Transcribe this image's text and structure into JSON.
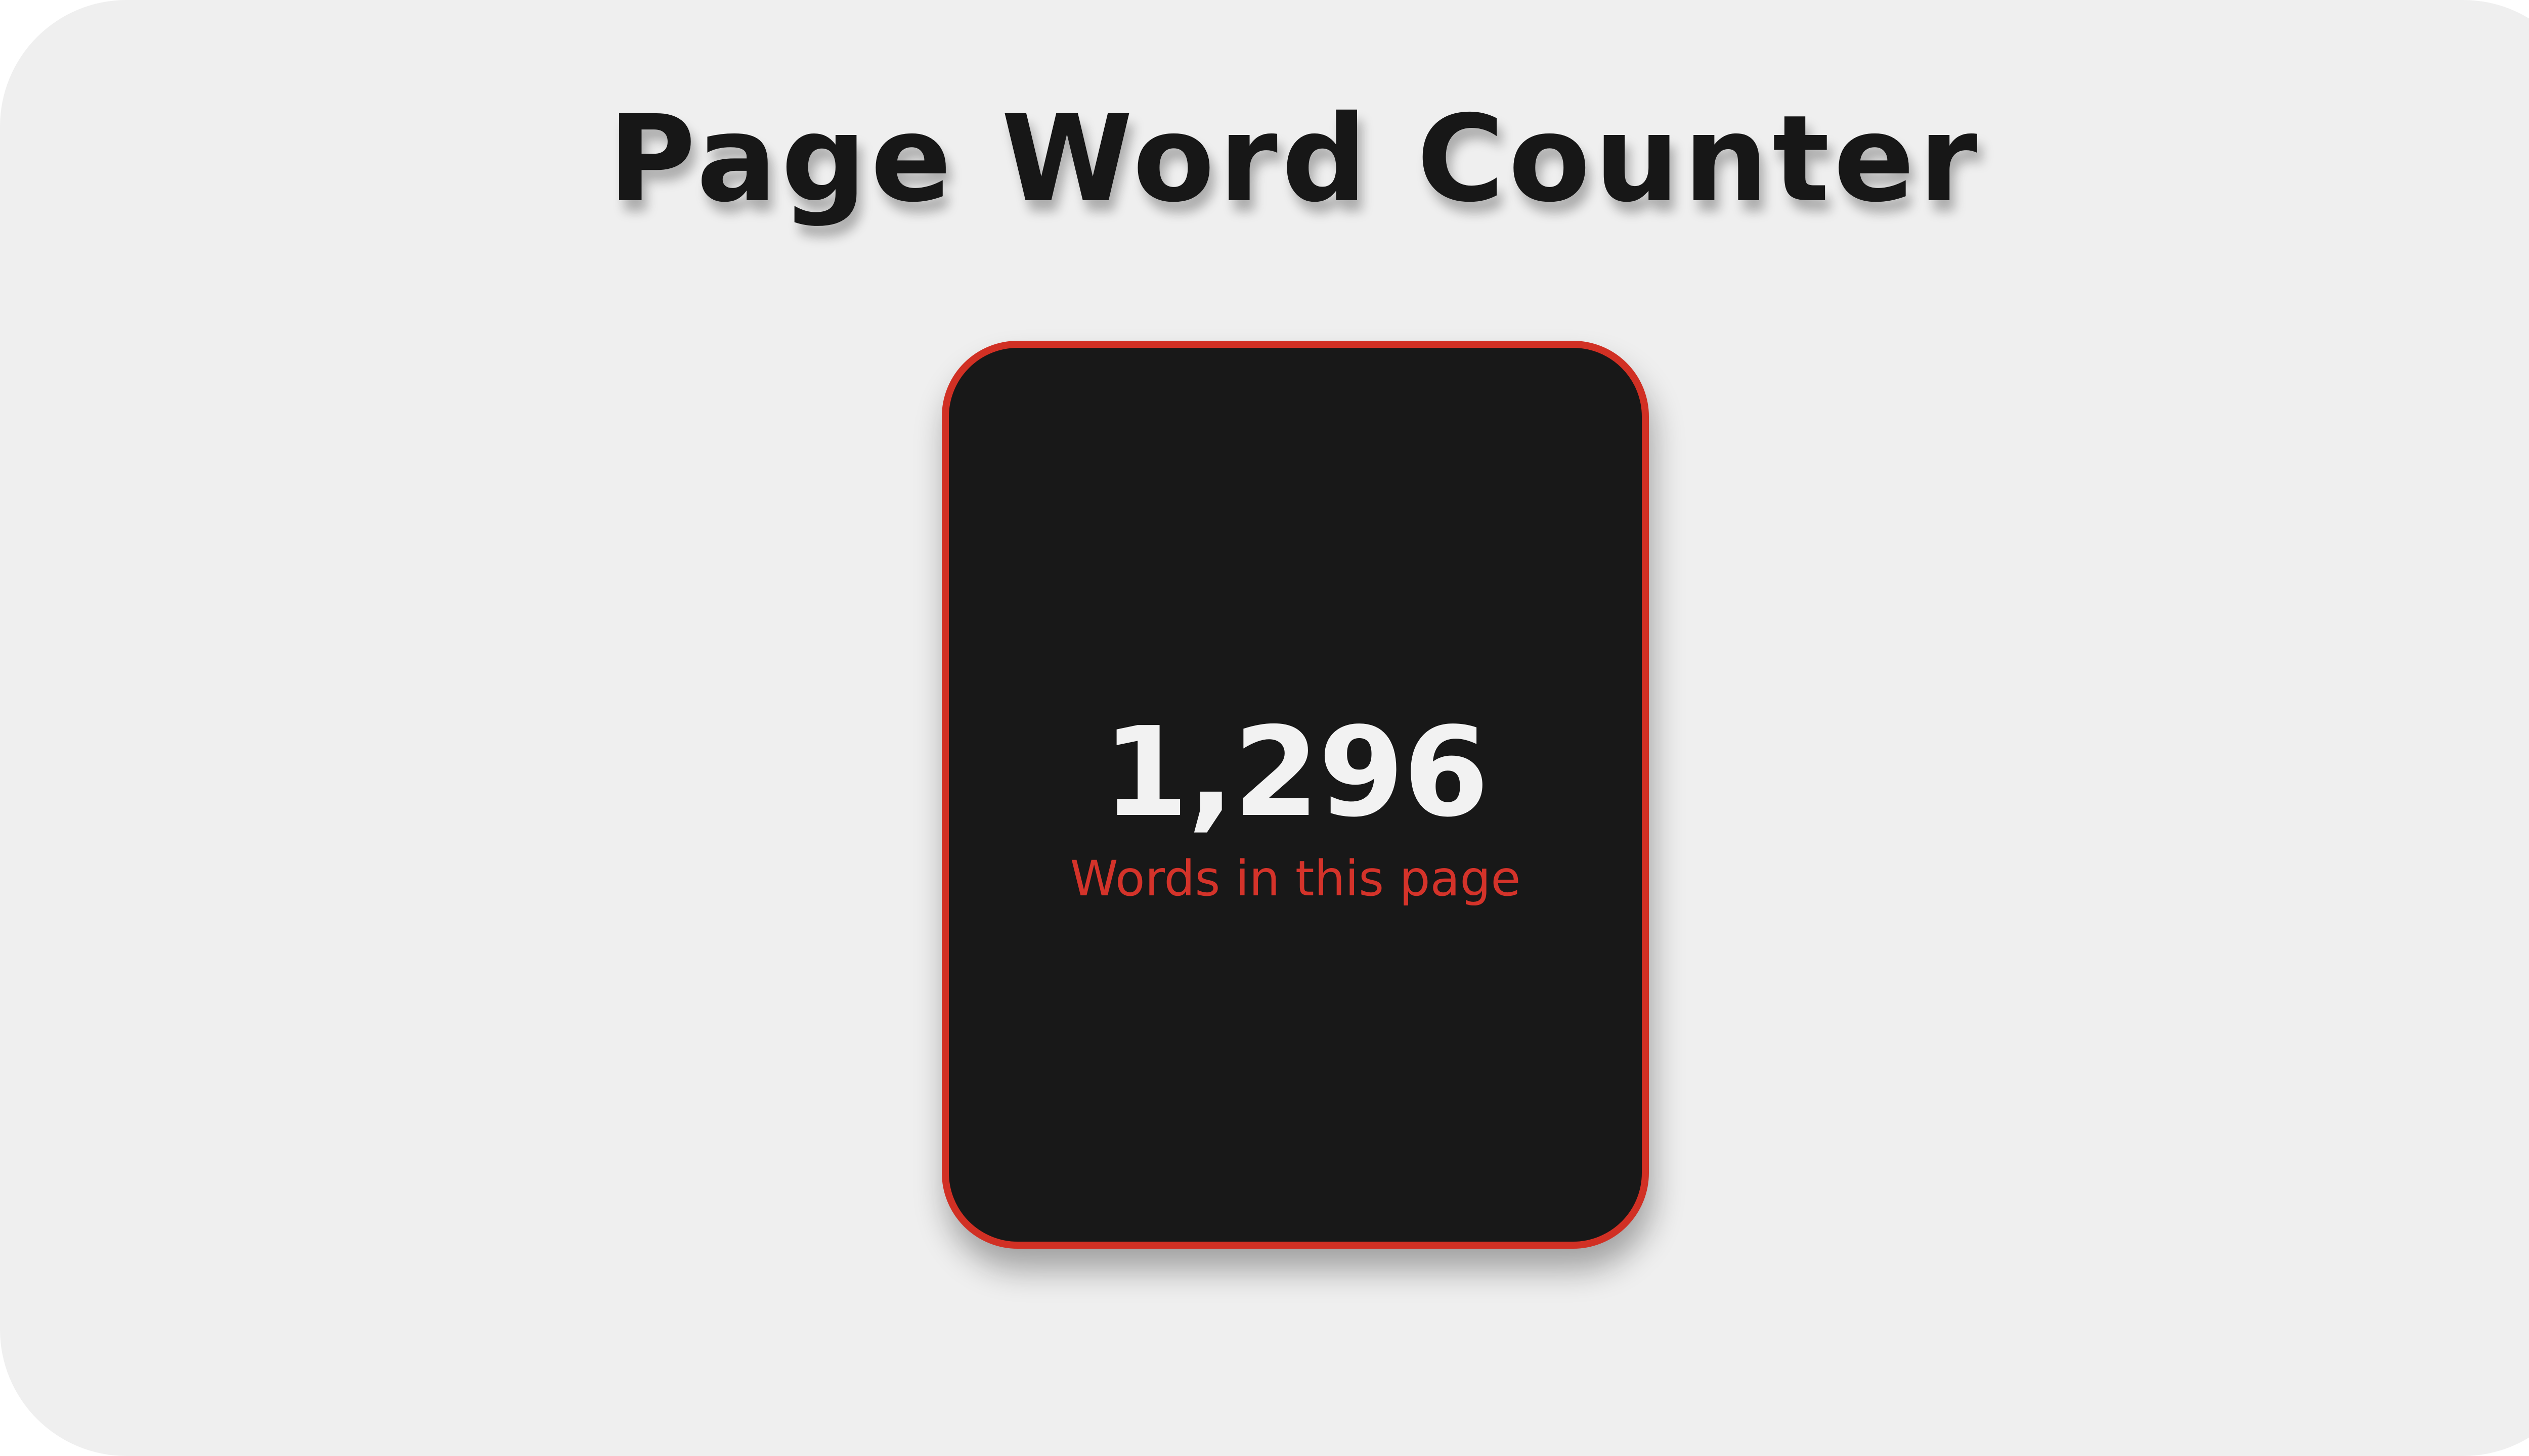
{
  "page": {
    "title": "Page Word Counter"
  },
  "counter": {
    "value": "1,296",
    "caption": "Words in this page",
    "accent_color": "#d13024",
    "card_color": "#181818"
  }
}
